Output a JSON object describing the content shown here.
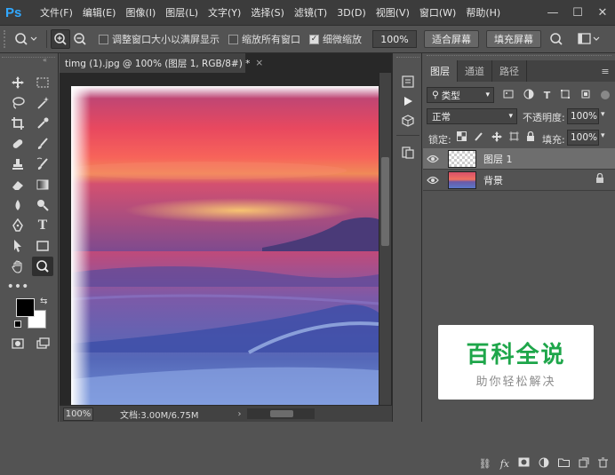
{
  "app": {
    "logo": "Ps"
  },
  "menu": [
    "文件(F)",
    "编辑(E)",
    "图像(I)",
    "图层(L)",
    "文字(Y)",
    "选择(S)",
    "滤镜(T)",
    "3D(D)",
    "视图(V)",
    "窗口(W)",
    "帮助(H)"
  ],
  "window_controls": {
    "minimize": "—",
    "maximize": "☐",
    "close": "✕"
  },
  "options_bar": {
    "resize_windows_label": "调整窗口大小以满屏显示",
    "resize_windows_checked": false,
    "zoom_all_windows_label": "缩放所有窗口",
    "zoom_all_windows_checked": false,
    "scrubby_zoom_label": "细微缩放",
    "scrubby_zoom_checked": true,
    "zoom_value": "100%",
    "fit_screen_label": "适合屏幕",
    "fill_screen_label": "填充屏幕"
  },
  "document": {
    "tab_title": "timg (1).jpg @ 100% (图层 1, RGB/8#) *",
    "close_glyph": "×",
    "status_zoom": "100%",
    "status_doc": "文档:3.00M/6.75M",
    "status_arrow": "›"
  },
  "layers_panel": {
    "tabs": [
      "图层",
      "通道",
      "路径"
    ],
    "active_tab": 0,
    "filter_kind": "类型",
    "blend_mode": "正常",
    "opacity_label": "不透明度:",
    "opacity_value": "100%",
    "lock_label": "锁定:",
    "fill_label": "填充:",
    "fill_value": "100%",
    "layers": [
      {
        "name": "图层 1",
        "selected": true,
        "visible": true,
        "locked": false
      },
      {
        "name": "背景",
        "selected": false,
        "visible": true,
        "locked": true
      }
    ]
  },
  "watermark": {
    "title": "百科全说",
    "subtitle": "助你轻松解决"
  },
  "colors": {
    "sky_top": "#c0497a",
    "sky_mid": "#f04a60",
    "horizon": "#f5a050",
    "sea": "#6a5aa8",
    "wave": "#4a6ac8",
    "accent": "#31a8ff"
  }
}
